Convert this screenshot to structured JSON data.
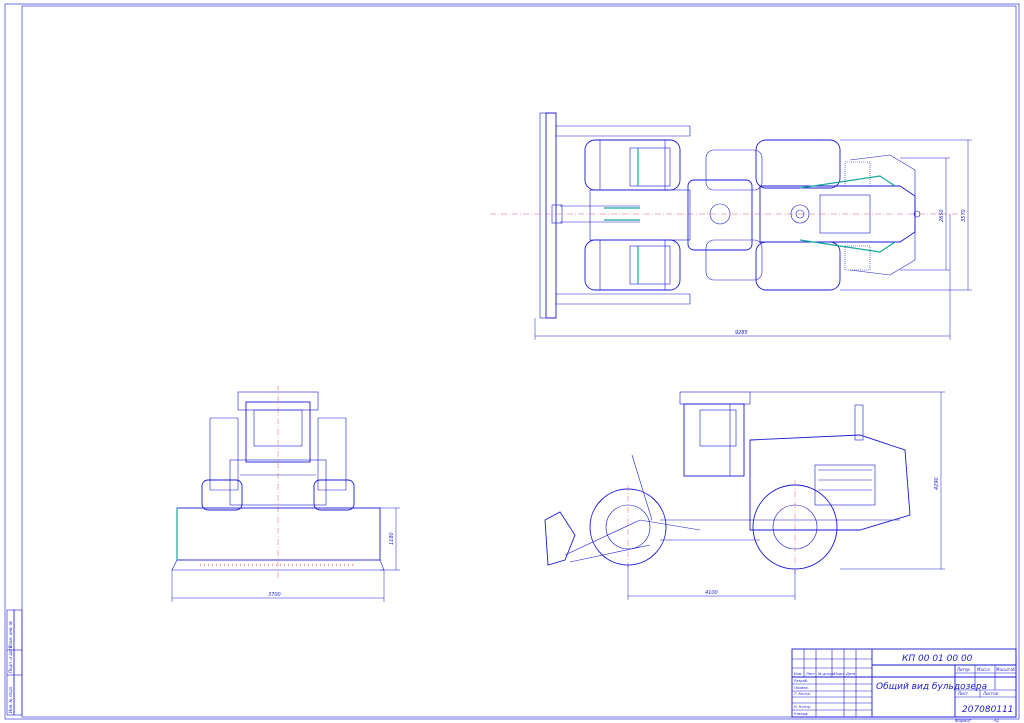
{
  "dimensions": {
    "top_length": "9285",
    "top_width_outer": "3570",
    "top_width_inner": "2650",
    "front_width": "3700",
    "front_blade_height": "1180",
    "side_wheelbase": "4100",
    "side_height": "4290"
  },
  "title_block": {
    "doc_code": "КП 00 01 00 00",
    "title": "Общий вид бульдозера",
    "doc_number": "207080111",
    "format_label": "Формат",
    "format_value": "А1",
    "col_litera": "Литер",
    "col_mass": "Масса",
    "col_scale": "Масштаб",
    "col_sheet": "Лист",
    "col_sheets": "Листов",
    "header_cells": [
      "Изм",
      "Лист",
      "№ докум",
      "Подп",
      "Дата"
    ],
    "row_labels": [
      "Разраб.",
      "Провер.",
      "Т. Контр.",
      "",
      "Н. Контр.",
      "Утверд."
    ]
  },
  "margin_labels": [
    "Инв. № подл.",
    "Подп. и дата",
    "Взам. инв. №"
  ]
}
